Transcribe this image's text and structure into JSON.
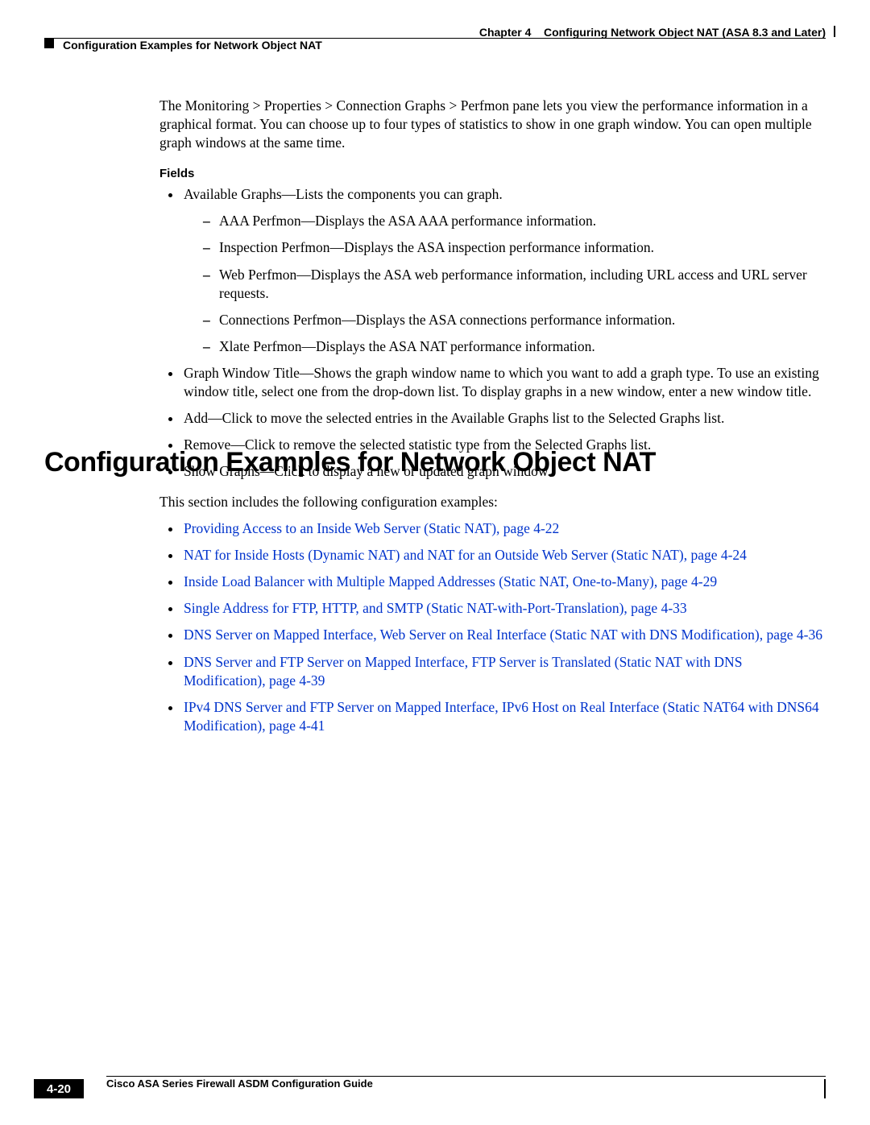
{
  "header": {
    "chapter_label": "Chapter 4",
    "chapter_title": "Configuring Network Object NAT (ASA 8.3 and Later)",
    "running_head": "Configuration Examples for Network Object NAT"
  },
  "intro_para": "The Monitoring > Properties > Connection Graphs > Perfmon pane lets you view the performance information in a graphical format. You can choose up to four types of statistics to show in one graph window. You can open multiple graph windows at the same time.",
  "fields_label": "Fields",
  "fields_items": [
    "Available Graphs—Lists the components you can graph.",
    "Graph Window Title—Shows the graph window name to which you want to add a graph type. To use an existing window title, select one from the drop-down list. To display graphs in a new window, enter a new window title.",
    "Add—Click to move the selected entries in the Available Graphs list to the Selected Graphs list.",
    "Remove—Click to remove the selected statistic type from the Selected Graphs list.",
    "Show Graphs—Click to display a new or updated graph window."
  ],
  "sub_items": [
    "AAA Perfmon—Displays the ASA AAA performance information.",
    "Inspection Perfmon—Displays the ASA inspection performance information.",
    "Web Perfmon—Displays the ASA web performance information, including URL access and URL server requests.",
    "Connections Perfmon—Displays the ASA connections performance information.",
    "Xlate Perfmon—Displays the ASA NAT performance information."
  ],
  "section_heading": "Configuration Examples for Network Object NAT",
  "section_intro": "This section includes the following configuration examples:",
  "links": [
    "Providing Access to an Inside Web Server (Static NAT), page 4-22",
    "NAT for Inside Hosts (Dynamic NAT) and NAT for an Outside Web Server (Static NAT), page 4-24",
    "Inside Load Balancer with Multiple Mapped Addresses (Static NAT, One-to-Many), page 4-29",
    "Single Address for FTP, HTTP, and SMTP (Static NAT-with-Port-Translation), page 4-33",
    "DNS Server on Mapped Interface, Web Server on Real Interface (Static NAT with DNS Modification), page 4-36",
    "DNS Server and FTP Server on Mapped Interface, FTP Server is Translated (Static NAT with DNS Modification), page 4-39",
    "IPv4 DNS Server and FTP Server on Mapped Interface, IPv6 Host on Real Interface (Static NAT64 with DNS64 Modification), page 4-41"
  ],
  "footer": {
    "guide_title": "Cisco ASA Series Firewall ASDM Configuration Guide",
    "page_number": "4-20"
  }
}
